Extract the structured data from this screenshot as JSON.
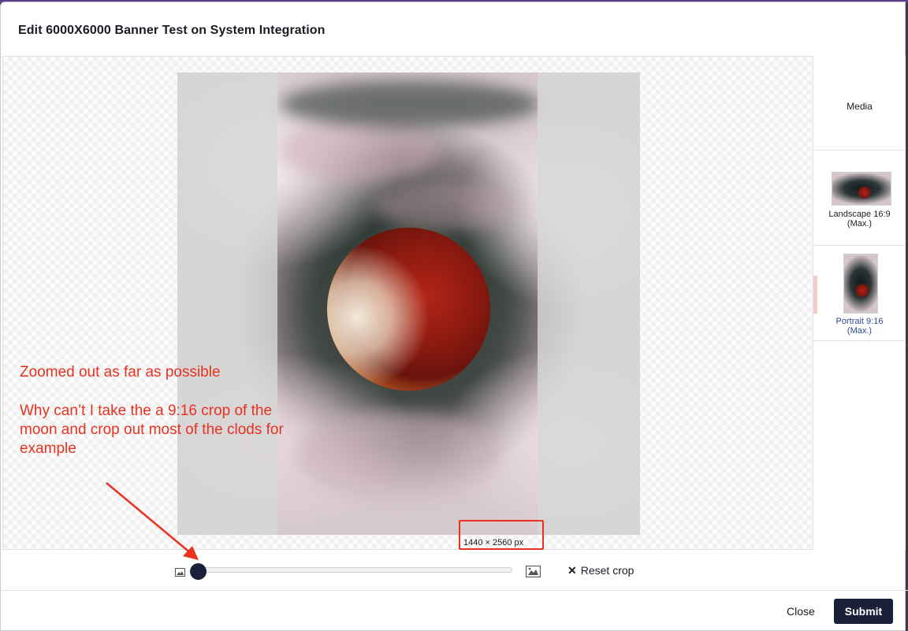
{
  "dialog": {
    "title": "Edit 6000X6000 Banner Test on System Integration"
  },
  "sidebar": {
    "media_label": "Media",
    "crops": [
      {
        "label_line1": "Landscape 16:9",
        "label_line2": "(Max.)",
        "active": false
      },
      {
        "label_line1": "Portrait 9:16",
        "label_line2": "(Max.)",
        "active": true
      }
    ]
  },
  "cropper": {
    "dimensions": "1440 × 2560 px",
    "zoom_percent": 0,
    "reset_label": "Reset crop"
  },
  "annotation": {
    "line1": "Zoomed out as far as possible",
    "line2": "Why can’t I take the a 9:16 crop of the moon and crop out most of the clods for example"
  },
  "footer": {
    "close_label": "Close",
    "submit_label": "Submit"
  },
  "colors": {
    "primary": "#1b2039",
    "annotation_red": "#e8321f",
    "active_crop_text": "#2f4a8c"
  }
}
